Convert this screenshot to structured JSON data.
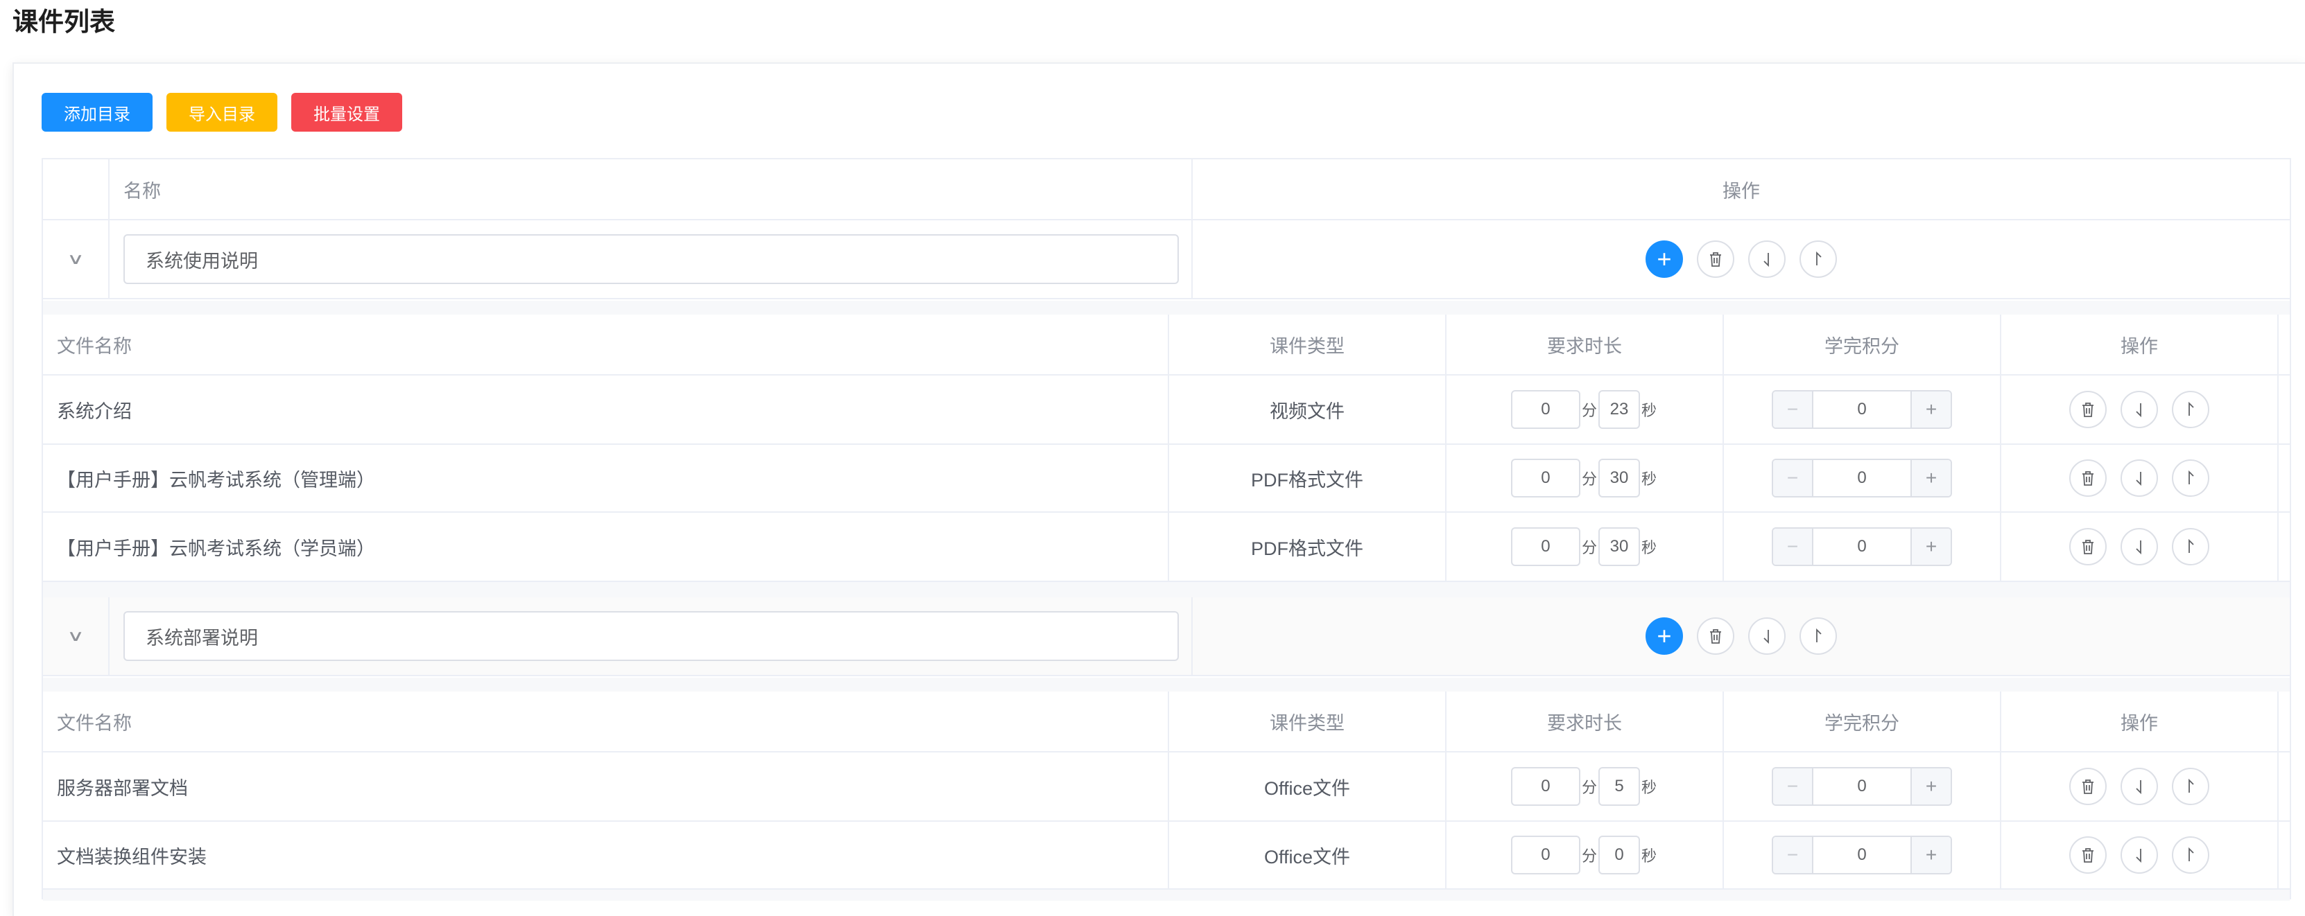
{
  "page": {
    "title": "课件列表"
  },
  "toolbar": {
    "add_dir": "添加目录",
    "import_dir": "导入目录",
    "batch_set": "批量设置",
    "colors": {
      "add": "#1890ff",
      "import": "#ffbb00",
      "batch": "#f5474f"
    }
  },
  "tree": {
    "header": {
      "name": "名称",
      "ops": "操作"
    },
    "file_header": {
      "name": "文件名称",
      "type": "课件类型",
      "duration": "要求时长",
      "score": "学完积分",
      "ops": "操作"
    },
    "units": {
      "min": "分",
      "sec": "秒"
    },
    "dirs": [
      {
        "name": "系统使用说明",
        "files": [
          {
            "name": "系统介绍",
            "type": "视频文件",
            "min": "0",
            "sec": "23",
            "score": "0"
          },
          {
            "name": "【用户手册】云帆考试系统（管理端）",
            "type": "PDF格式文件",
            "min": "0",
            "sec": "30",
            "score": "0"
          },
          {
            "name": "【用户手册】云帆考试系统（学员端）",
            "type": "PDF格式文件",
            "min": "0",
            "sec": "30",
            "score": "0"
          }
        ]
      },
      {
        "name": "系统部署说明",
        "files": [
          {
            "name": "服务器部署文档",
            "type": "Office文件",
            "min": "0",
            "sec": "5",
            "score": "0"
          },
          {
            "name": "文档装换组件安装",
            "type": "Office文件",
            "min": "0",
            "sec": "0",
            "score": "0"
          }
        ]
      }
    ]
  },
  "icons": {
    "expand": "chevron-down-icon",
    "add": "plus-icon",
    "delete": "trash-icon",
    "move_down": "arrow-down-icon",
    "move_up": "arrow-up-icon",
    "decrease": "minus-icon",
    "increase": "plus-icon"
  }
}
